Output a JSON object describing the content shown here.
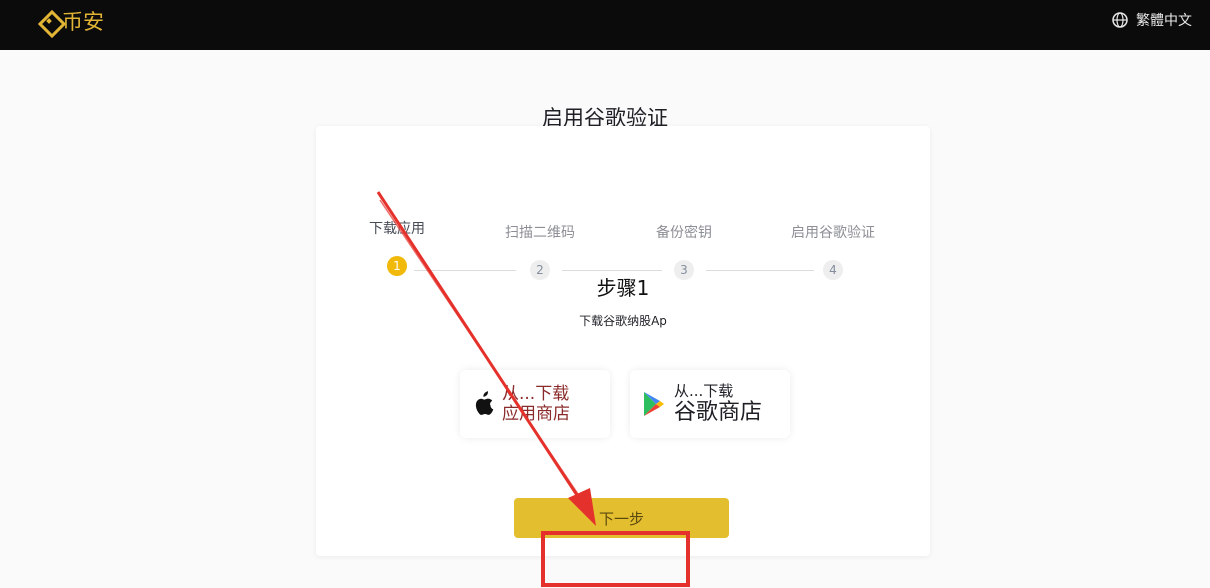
{
  "header": {
    "logo_text": "币安",
    "language": "繁體中文",
    "brand_color": "#e2b535",
    "background": "#0b0b0c"
  },
  "page": {
    "title": "启用谷歌验证"
  },
  "steps": [
    {
      "label": "下载应用",
      "number": "1",
      "active": true
    },
    {
      "label": "扫描二维码",
      "number": "2",
      "active": false
    },
    {
      "label": "备份密钥",
      "number": "3",
      "active": false
    },
    {
      "label": "启用谷歌验证",
      "number": "4",
      "active": false
    }
  ],
  "content": {
    "heading": "步骤1",
    "description": "下载谷歌纳股Ap",
    "apple_store": {
      "line1": "从...下载",
      "line2": "应用商店",
      "icon": "apple-icon"
    },
    "google_store": {
      "line1": "从...下载",
      "line2": "谷歌商店",
      "icon": "google-play-icon"
    },
    "next_label": "下一步"
  },
  "colors": {
    "accent": "#f0b90b",
    "button": "#e3be2e",
    "annotation_red": "#e5312b"
  }
}
